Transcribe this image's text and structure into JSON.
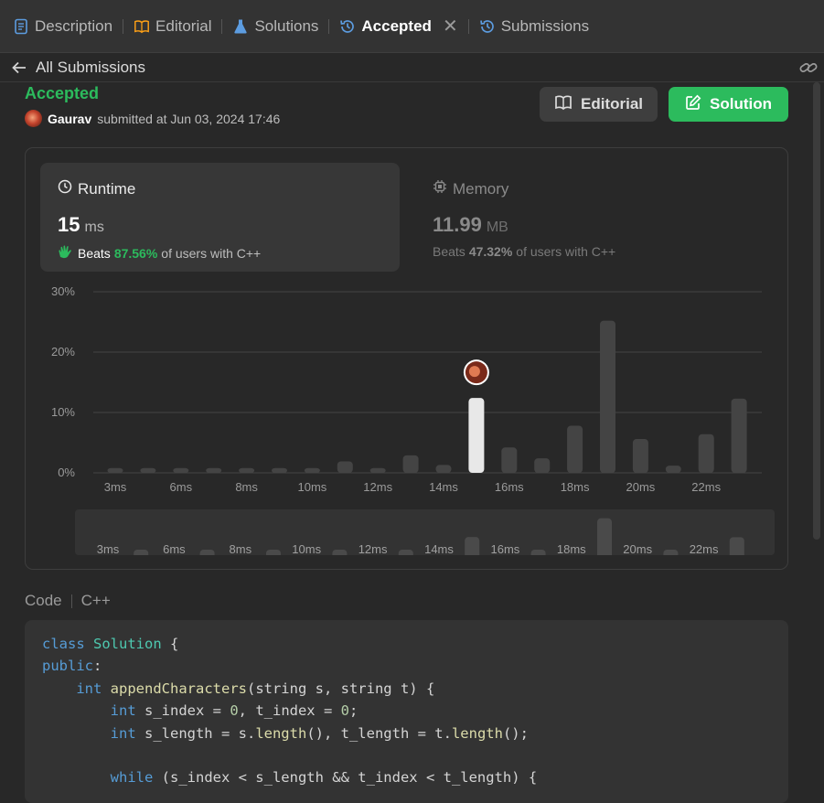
{
  "tabs": [
    {
      "label": "Description",
      "icon": "description-icon",
      "color": "#5c9ce0",
      "active": false
    },
    {
      "label": "Editorial",
      "icon": "book-icon",
      "color": "#ffa116",
      "active": false
    },
    {
      "label": "Solutions",
      "icon": "flask-icon",
      "color": "#5c9ce0",
      "active": false
    },
    {
      "label": "Accepted",
      "icon": "history-icon",
      "color": "#5c9ce0",
      "active": true
    },
    {
      "label": "Submissions",
      "icon": "history-icon",
      "color": "#5c9ce0",
      "active": false
    }
  ],
  "subheader": {
    "back_label": "All Submissions"
  },
  "submission": {
    "status": "Accepted",
    "user": "Gaurav",
    "submitted_text": "submitted at Jun 03, 2024 17:46"
  },
  "buttons": {
    "editorial": "Editorial",
    "solution": "Solution"
  },
  "runtime": {
    "title": "Runtime",
    "value": "15",
    "unit": "ms",
    "beats_prefix": "Beats",
    "beats_pct": "87.56%",
    "beats_suffix": "of users with C++"
  },
  "memory": {
    "title": "Memory",
    "value": "11.99",
    "unit": "MB",
    "beats_prefix": "Beats",
    "beats_pct": "47.32%",
    "beats_suffix": "of users with C++"
  },
  "chart_data": {
    "type": "bar",
    "ylabel": "",
    "xlabel": "",
    "y_ticks": [
      "30%",
      "20%",
      "10%",
      "0%"
    ],
    "ylim": [
      0,
      30
    ],
    "x_tick_labels": [
      "3ms",
      "6ms",
      "8ms",
      "10ms",
      "12ms",
      "14ms",
      "16ms",
      "18ms",
      "20ms",
      "22ms"
    ],
    "highlight_index": 11,
    "values": [
      0.8,
      0.8,
      0.8,
      0.8,
      0.8,
      0.8,
      0.8,
      1.9,
      0.8,
      2.9,
      1.3,
      12.4,
      4.2,
      2.4,
      7.8,
      25.2,
      5.6,
      1.2,
      6.4,
      12.3
    ],
    "colors": {
      "bar": "#444444",
      "highlight": "#e8e8e8",
      "grid": "#444444",
      "axis_text": "#9a9a9a"
    }
  },
  "code": {
    "header": "Code",
    "language": "C++",
    "lines": [
      [
        [
          "kw",
          "class"
        ],
        [
          "p",
          " "
        ],
        [
          "ty",
          "Solution"
        ],
        [
          "p",
          " {"
        ]
      ],
      [
        [
          "kw",
          "public"
        ],
        [
          "p",
          ":"
        ]
      ],
      [
        [
          "p",
          "    "
        ],
        [
          "kw",
          "int"
        ],
        [
          "p",
          " "
        ],
        [
          "fn",
          "appendCharacters"
        ],
        [
          "p",
          "(string s, string t) {"
        ]
      ],
      [
        [
          "p",
          "        "
        ],
        [
          "kw",
          "int"
        ],
        [
          "p",
          " s_index = "
        ],
        [
          "nm",
          "0"
        ],
        [
          "p",
          ", t_index = "
        ],
        [
          "nm",
          "0"
        ],
        [
          "p",
          ";"
        ]
      ],
      [
        [
          "p",
          "        "
        ],
        [
          "kw",
          "int"
        ],
        [
          "p",
          " s_length = s."
        ],
        [
          "fn",
          "length"
        ],
        [
          "p",
          "(), t_length = t."
        ],
        [
          "fn",
          "length"
        ],
        [
          "p",
          "();"
        ]
      ],
      [
        [
          "p",
          ""
        ]
      ],
      [
        [
          "p",
          "        "
        ],
        [
          "ctl",
          "while"
        ],
        [
          "p",
          " (s_index < s_length && t_index < t_length) {"
        ]
      ]
    ]
  }
}
